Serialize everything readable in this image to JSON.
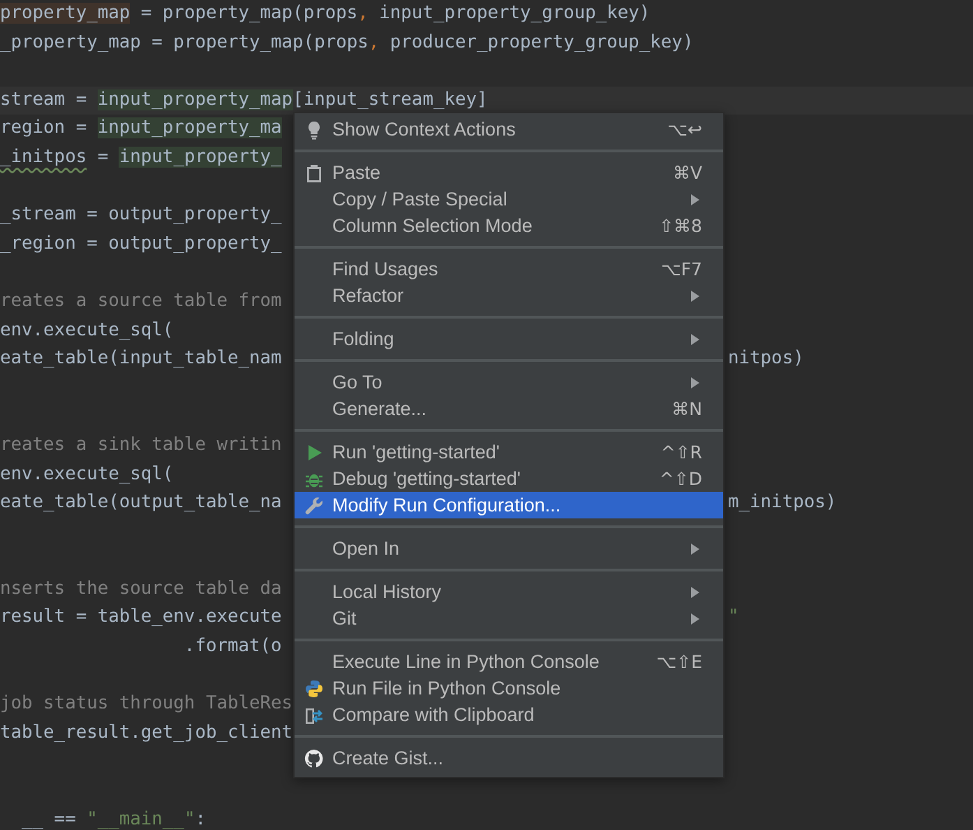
{
  "code_lines": [
    {
      "kind": "code",
      "left": [
        {
          "text": "property_map",
          "kind": "write"
        },
        {
          "text": " = property_map(props",
          "kind": "plain"
        },
        {
          "text": ",",
          "kind": "punct"
        },
        {
          "text": " input_property_group_key)",
          "kind": "plain"
        }
      ]
    },
    {
      "kind": "code",
      "left": [
        {
          "text": "_property_map = property_map(props",
          "kind": "plain"
        },
        {
          "text": ",",
          "kind": "punct"
        },
        {
          "text": " producer_property_group_key)",
          "kind": "plain"
        }
      ]
    },
    {
      "kind": "blank"
    },
    {
      "kind": "code",
      "current": true,
      "left": [
        {
          "text": "stream = ",
          "kind": "plain"
        },
        {
          "text": "input_property_map",
          "kind": "usage"
        },
        {
          "text": "[input_stream_key]",
          "kind": "plain"
        }
      ]
    },
    {
      "kind": "code",
      "left": [
        {
          "text": "region = ",
          "kind": "plain"
        },
        {
          "text": "input_property_ma",
          "kind": "usage"
        }
      ]
    },
    {
      "kind": "code",
      "left": [
        {
          "text": "_initpos",
          "kind": "warn"
        },
        {
          "text": " = ",
          "kind": "plain"
        },
        {
          "text": "input_property_",
          "kind": "usage"
        }
      ]
    },
    {
      "kind": "blank"
    },
    {
      "kind": "code",
      "left": [
        {
          "text": "_stream = output_property_",
          "kind": "plain"
        }
      ]
    },
    {
      "kind": "code",
      "left": [
        {
          "text": "_region = output_property_",
          "kind": "plain"
        }
      ]
    },
    {
      "kind": "blank"
    },
    {
      "kind": "code",
      "left": [
        {
          "text": "reates a source table from",
          "kind": "comment"
        }
      ]
    },
    {
      "kind": "code",
      "left": [
        {
          "text": "env.execute_sql(",
          "kind": "plain"
        }
      ]
    },
    {
      "kind": "code",
      "left": [
        {
          "text": "eate_table(input_table_nam",
          "kind": "plain"
        }
      ],
      "right": [
        {
          "text": "nitpos)",
          "kind": "plain"
        }
      ]
    },
    {
      "kind": "blank"
    },
    {
      "kind": "blank"
    },
    {
      "kind": "code",
      "left": [
        {
          "text": "reates a sink table writin",
          "kind": "comment"
        }
      ]
    },
    {
      "kind": "code",
      "left": [
        {
          "text": "env.execute_sql(",
          "kind": "plain"
        }
      ]
    },
    {
      "kind": "code",
      "left": [
        {
          "text": "eate_table(output_table_na",
          "kind": "plain"
        }
      ],
      "right": [
        {
          "text": "m_initpos)",
          "kind": "plain"
        }
      ]
    },
    {
      "kind": "blank"
    },
    {
      "kind": "blank"
    },
    {
      "kind": "code",
      "left": [
        {
          "text": "nserts the source table da",
          "kind": "comment"
        }
      ]
    },
    {
      "kind": "code",
      "left": [
        {
          "text": "result = table_env.execute",
          "kind": "plain"
        }
      ],
      "right": [
        {
          "text": "\"",
          "kind": "string"
        }
      ]
    },
    {
      "kind": "code",
      "left": [
        {
          "text": "                 .format(o",
          "kind": "plain"
        }
      ]
    },
    {
      "kind": "blank"
    },
    {
      "kind": "code",
      "left": [
        {
          "text": "job status through TableRes",
          "kind": "comment"
        }
      ]
    },
    {
      "kind": "code",
      "left": [
        {
          "text": "table_result.get_job_client",
          "kind": "plain"
        }
      ]
    },
    {
      "kind": "blank"
    },
    {
      "kind": "blank"
    },
    {
      "kind": "code",
      "left": [
        {
          "text": "  __ == ",
          "kind": "plain"
        },
        {
          "text": "\"__main__\"",
          "kind": "string"
        },
        {
          "text": ":",
          "kind": "plain"
        }
      ]
    }
  ],
  "context_menu": {
    "groups": [
      {
        "items": [
          {
            "label": "Show Context Actions",
            "shortcut": "⌥↩",
            "kind": "bulb",
            "submenu": false,
            "selected": false
          }
        ]
      },
      {
        "items": [
          {
            "label": "Paste",
            "shortcut": "⌘V",
            "kind": "clipboard",
            "submenu": false,
            "selected": false
          },
          {
            "label": "Copy / Paste Special",
            "kind": "plain",
            "submenu": true,
            "selected": false
          },
          {
            "label": "Column Selection Mode",
            "shortcut": "⇧⌘8",
            "kind": "plain",
            "submenu": false,
            "selected": false
          }
        ]
      },
      {
        "items": [
          {
            "label": "Find Usages",
            "shortcut": "⌥F7",
            "kind": "plain",
            "submenu": false,
            "selected": false
          },
          {
            "label": "Refactor",
            "kind": "plain",
            "submenu": true,
            "selected": false
          }
        ]
      },
      {
        "items": [
          {
            "label": "Folding",
            "kind": "plain",
            "submenu": true,
            "selected": false
          }
        ]
      },
      {
        "items": [
          {
            "label": "Go To",
            "kind": "plain",
            "submenu": true,
            "selected": false
          },
          {
            "label": "Generate...",
            "shortcut": "⌘N",
            "kind": "plain",
            "submenu": false,
            "selected": false
          }
        ]
      },
      {
        "items": [
          {
            "label": "Run 'getting-started'",
            "shortcut": "^⇧R",
            "kind": "play",
            "submenu": false,
            "selected": false
          },
          {
            "label": "Debug 'getting-started'",
            "shortcut": "^⇧D",
            "kind": "bug",
            "submenu": false,
            "selected": false
          },
          {
            "label": "Modify Run Configuration...",
            "kind": "wrench",
            "submenu": false,
            "selected": true
          }
        ]
      },
      {
        "items": [
          {
            "label": "Open In",
            "kind": "plain",
            "submenu": true,
            "selected": false
          }
        ]
      },
      {
        "items": [
          {
            "label": "Local History",
            "kind": "plain",
            "submenu": true,
            "selected": false
          },
          {
            "label": "Git",
            "kind": "plain",
            "submenu": true,
            "selected": false
          }
        ]
      },
      {
        "items": [
          {
            "label": "Execute Line in Python Console",
            "shortcut": "⌥⇧E",
            "kind": "plain",
            "submenu": false,
            "selected": false
          },
          {
            "label": "Run File in Python Console",
            "kind": "python",
            "submenu": false,
            "selected": false
          },
          {
            "label": "Compare with Clipboard",
            "kind": "compare",
            "submenu": false,
            "selected": false
          }
        ]
      },
      {
        "items": [
          {
            "label": "Create Gist...",
            "kind": "cat",
            "submenu": false,
            "selected": false
          }
        ]
      }
    ]
  }
}
